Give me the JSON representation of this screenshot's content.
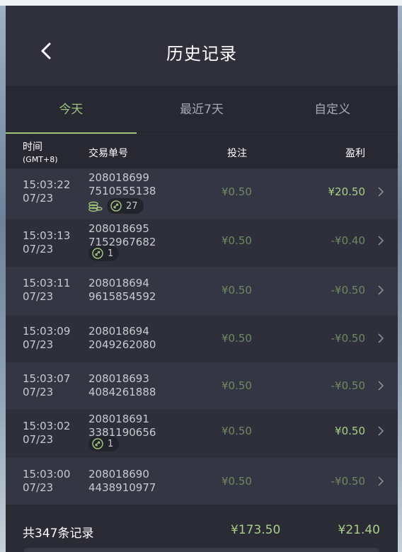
{
  "header": {
    "title": "历史记录",
    "back_icon": "chevron-left-icon"
  },
  "tabs": [
    {
      "label": "今天",
      "active": true
    },
    {
      "label": "最近7天",
      "active": false
    },
    {
      "label": "自定义",
      "active": false
    }
  ],
  "columns": {
    "time": "时间",
    "timezone": "(GMT+8)",
    "order": "交易单号",
    "bet": "投注",
    "profit": "盈利"
  },
  "rows": [
    {
      "time": "15:03:22",
      "date": "07/23",
      "order1": "208018699",
      "order2": "7510555138",
      "bet": "¥0.50",
      "profit": "¥20.50",
      "win": true,
      "coins": true,
      "cycles": "27"
    },
    {
      "time": "15:03:13",
      "date": "07/23",
      "order1": "208018695",
      "order2": "7152967682",
      "bet": "¥0.50",
      "profit": "-¥0.40",
      "win": false,
      "coins": false,
      "cycles": "1"
    },
    {
      "time": "15:03:11",
      "date": "07/23",
      "order1": "208018694",
      "order2": "9615854592",
      "bet": "¥0.50",
      "profit": "-¥0.50",
      "win": false,
      "coins": false,
      "cycles": ""
    },
    {
      "time": "15:03:09",
      "date": "07/23",
      "order1": "208018694",
      "order2": "2049262080",
      "bet": "¥0.50",
      "profit": "-¥0.50",
      "win": false,
      "coins": false,
      "cycles": ""
    },
    {
      "time": "15:03:07",
      "date": "07/23",
      "order1": "208018693",
      "order2": "4084261888",
      "bet": "¥0.50",
      "profit": "-¥0.50",
      "win": false,
      "coins": false,
      "cycles": ""
    },
    {
      "time": "15:03:02",
      "date": "07/23",
      "order1": "208018691",
      "order2": "3381190656",
      "bet": "¥0.50",
      "profit": "¥0.50",
      "win": true,
      "coins": false,
      "cycles": "1"
    },
    {
      "time": "15:03:00",
      "date": "07/23",
      "order1": "208018690",
      "order2": "4438910977",
      "bet": "¥0.50",
      "profit": "-¥0.50",
      "win": false,
      "coins": false,
      "cycles": ""
    }
  ],
  "footer": {
    "total_label": "共347条记录",
    "total_bet": "¥173.50",
    "total_profit": "¥21.40"
  },
  "colors": {
    "accent": "#9fc37e",
    "win": "#a9cf86",
    "muted": "#6f8960",
    "bg": "#2e2f3a"
  }
}
